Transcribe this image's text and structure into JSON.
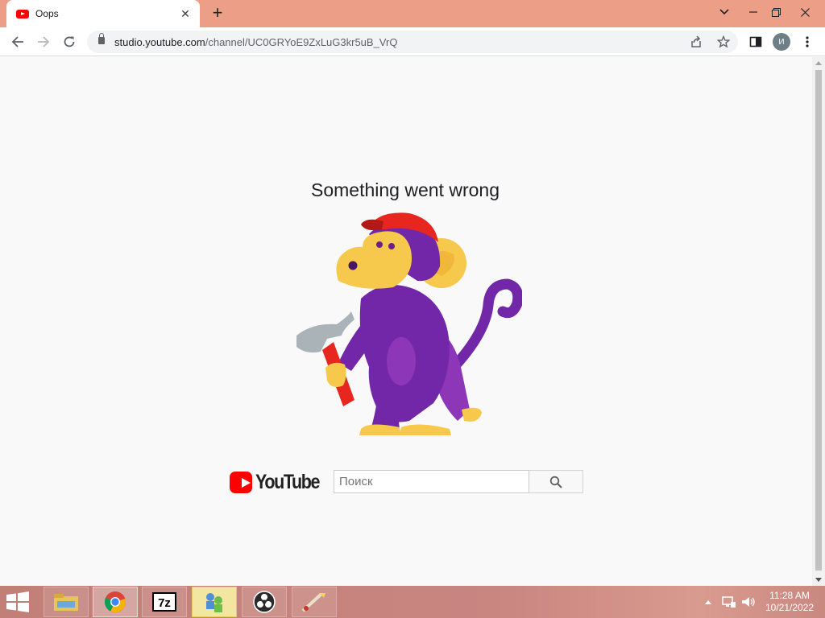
{
  "browser": {
    "tab_title": "Oops",
    "tab_close": "✕",
    "new_tab": "+",
    "url_host": "studio.youtube.com",
    "url_path": "/channel/UC0GRYoE9ZxLuG3kr5uB_VrQ",
    "avatar_letter": "И"
  },
  "page": {
    "error_title": "Something went wrong",
    "logo_text": "YouTube",
    "search_placeholder": "Поиск"
  },
  "taskbar": {
    "apps": [
      "file-explorer",
      "chrome",
      "7-zip",
      "network-app",
      "obs-studio",
      "paint-app"
    ],
    "clock_time": "11:28 AM",
    "clock_date": "10/21/2022"
  },
  "colors": {
    "titlebar": "#ec9f86",
    "youtube_red": "#ff0000",
    "monkey_purple": "#7127a8",
    "monkey_yellow": "#f6c94d",
    "cap_red": "#e6261f"
  }
}
